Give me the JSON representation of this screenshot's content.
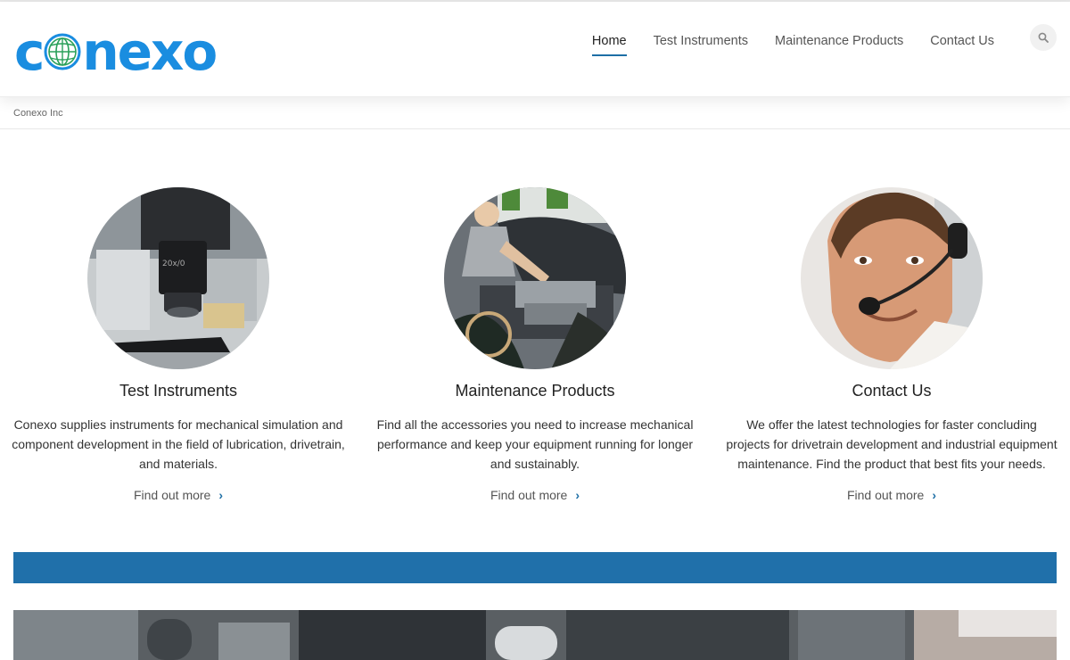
{
  "site": {
    "logo_text_left": "c",
    "logo_text_right": "nexo"
  },
  "nav": {
    "items": [
      {
        "label": "Home",
        "active": true
      },
      {
        "label": "Test Instruments",
        "active": false
      },
      {
        "label": "Maintenance Products",
        "active": false
      },
      {
        "label": "Contact Us",
        "active": false
      }
    ],
    "search_icon": "search-icon"
  },
  "breadcrumb": {
    "current": "Conexo Inc"
  },
  "features": [
    {
      "title": "Test Instruments",
      "text": "Conexo supplies instruments for mechanical simulation and component development in the field of lubrication, drivetrain, and materials.",
      "link": "Find out more"
    },
    {
      "title": "Maintenance Products",
      "text": "Find all the accessories you need to increase mechanical performance and keep your equipment running for longer and sustainably.",
      "link": "Find out more"
    },
    {
      "title": "Contact Us",
      "text": "We offer the latest technologies for faster concluding projects for drivetrain development and industrial equipment maintenance. Find the product that best fits your needs.",
      "link": "Find out more"
    }
  ],
  "colors": {
    "brand": "#1a8de0",
    "accent": "#2070aa",
    "nav_underline": "#1e6fa6"
  }
}
